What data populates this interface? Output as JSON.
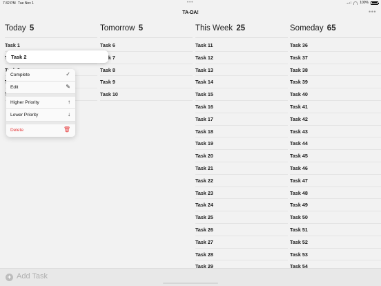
{
  "status_bar": {
    "time": "7:32 PM",
    "date": "Tue Nov 1",
    "battery": "100%",
    "multitask_dots": "•••"
  },
  "nav": {
    "title": "TA-DA!",
    "more_icon": "ellipsis-icon",
    "more_glyph": "•••"
  },
  "columns": [
    {
      "title": "Today",
      "count": "5",
      "tasks": [
        "Task 1",
        "Task 2",
        "Task 3",
        "Task 4",
        "Task 5"
      ]
    },
    {
      "title": "Tomorrow",
      "count": "5",
      "tasks": [
        "Task 6",
        "Task 7",
        "Task 8",
        "Task 9",
        "Task 10"
      ]
    },
    {
      "title": "This Week",
      "count": "25",
      "tasks": [
        "Task 11",
        "Task 12",
        "Task 13",
        "Task 14",
        "Task 15",
        "Task 16",
        "Task 17",
        "Task 18",
        "Task 19",
        "Task 20",
        "Task 21",
        "Task 22",
        "Task 23",
        "Task 24",
        "Task 25",
        "Task 26",
        "Task 27",
        "Task 28",
        "Task 29"
      ]
    },
    {
      "title": "Someday",
      "count": "65",
      "tasks": [
        "Task 36",
        "Task 37",
        "Task 38",
        "Task 39",
        "Task 40",
        "Task 41",
        "Task 42",
        "Task 43",
        "Task 44",
        "Task 45",
        "Task 46",
        "Task 47",
        "Task 48",
        "Task 49",
        "Task 50",
        "Task 51",
        "Task 52",
        "Task 53",
        "Task 54"
      ]
    }
  ],
  "lifted_task": {
    "label": "Task 2"
  },
  "context_menu": {
    "complete": {
      "label": "Complete",
      "icon": "checkmark-icon",
      "glyph": "✓"
    },
    "edit": {
      "label": "Edit",
      "icon": "pencil-icon",
      "glyph": "✎"
    },
    "higher_priority": {
      "label": "Higher Priority",
      "icon": "arrow-up-icon",
      "glyph": "↑"
    },
    "lower_priority": {
      "label": "Lower Priority",
      "icon": "arrow-down-icon",
      "glyph": "↓"
    },
    "delete": {
      "label": "Delete",
      "icon": "trash-icon",
      "glyph": "🗑"
    }
  },
  "bottom_bar": {
    "add_label": "Add Task",
    "add_icon": "plus-circle-icon",
    "add_glyph": "+"
  },
  "colors": {
    "background": "#f2f2f2",
    "danger": "#e5393a",
    "text": "#111111"
  }
}
